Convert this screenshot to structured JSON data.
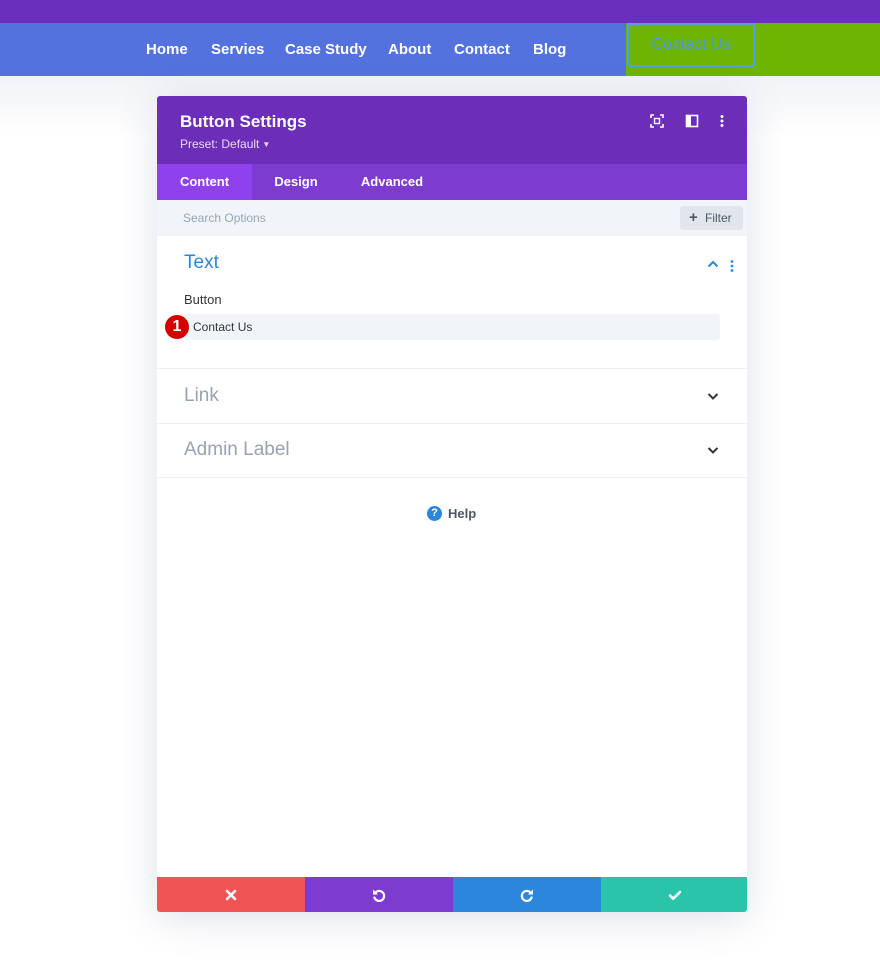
{
  "site": {
    "nav": [
      "Home",
      "Servies",
      "Case Study",
      "About",
      "Contact",
      "Blog"
    ],
    "cta_label": "Contact Us"
  },
  "modal": {
    "title": "Button Settings",
    "preset": "Preset: Default",
    "header_icons": [
      "focus-mode-icon",
      "split-view-icon",
      "more-options-icon"
    ],
    "tabs": [
      {
        "label": "Content",
        "active": true
      },
      {
        "label": "Design",
        "active": false
      },
      {
        "label": "Advanced",
        "active": false
      }
    ],
    "search": {
      "placeholder": "Search Options",
      "value": ""
    },
    "filter_label": "Filter",
    "sections": {
      "text": {
        "title": "Text",
        "expanded": true,
        "field_label": "Button",
        "field_value": "Contact Us",
        "step_badge": "1"
      },
      "link": {
        "title": "Link",
        "expanded": false
      },
      "admin": {
        "title": "Admin Label",
        "expanded": false
      }
    },
    "help_label": "Help",
    "footer_buttons": [
      {
        "name": "discard",
        "icon": "close-icon",
        "color": "#ef5555"
      },
      {
        "name": "undo",
        "icon": "undo-icon",
        "color": "#7e3bd0"
      },
      {
        "name": "redo",
        "icon": "redo-icon",
        "color": "#2b87da"
      },
      {
        "name": "save",
        "icon": "check-icon",
        "color": "#29c4a9"
      }
    ]
  },
  "colors": {
    "top_strip": "#6a2fbd",
    "navbar": "#5472de",
    "cta_block": "#6db500",
    "header": "#6c2eb9",
    "tab_bar": "#7e3bd0",
    "tab_active": "#8f42ec",
    "accent_blue": "#2b87da",
    "badge_red": "#d40000"
  }
}
